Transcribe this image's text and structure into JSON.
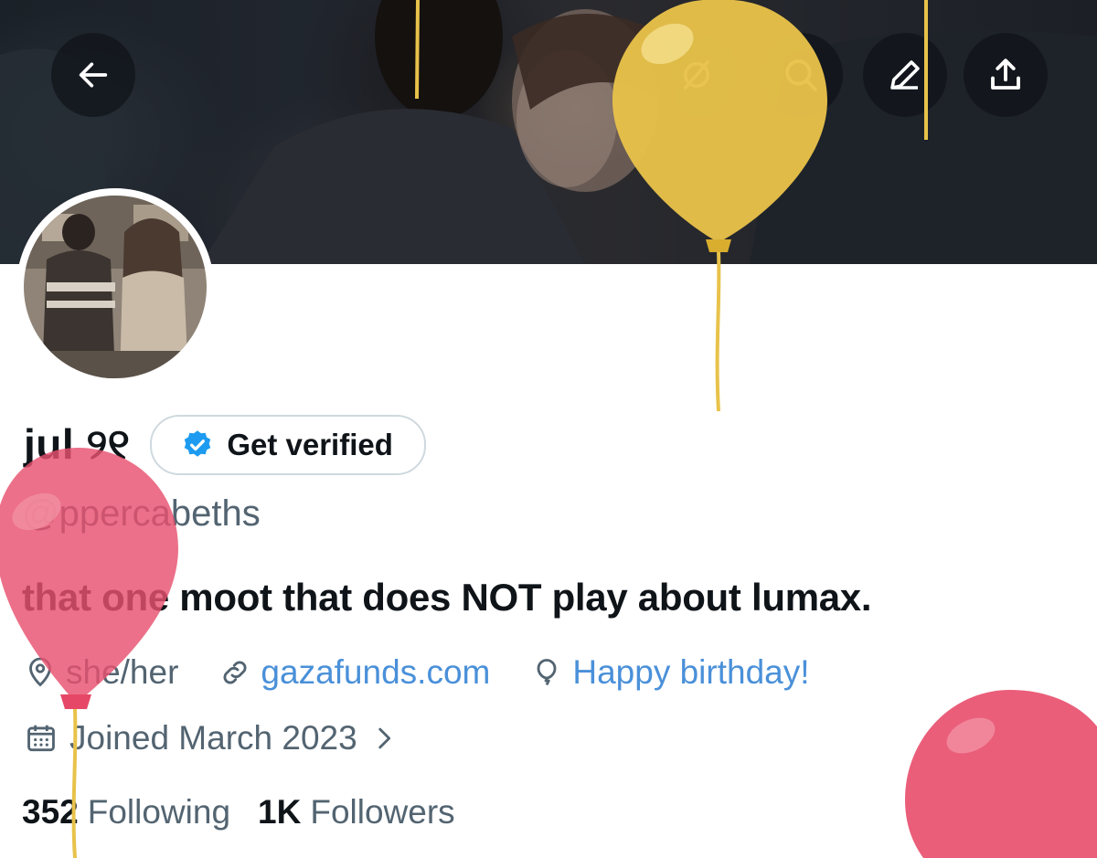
{
  "profile": {
    "display_name": "jul ୨୧",
    "verify_label": "Get verified",
    "handle": "@ppercabeths",
    "bio": "that one moot that does NOT play about lumax.",
    "location": "she/her",
    "website": "gazafunds.com",
    "birthday": "Happy birthday!",
    "joined": "Joined March 2023",
    "following_count": "352",
    "following_label": "Following",
    "followers_count": "1K",
    "followers_label": "Followers"
  },
  "icons": {
    "back": "back-arrow-icon",
    "grok": "grok-icon",
    "search": "search-icon",
    "edit": "edit-pencil-icon",
    "share": "share-icon",
    "verified": "verified-badge-icon",
    "location": "location-pin-icon",
    "link": "link-icon",
    "birthday": "balloon-icon",
    "calendar": "calendar-icon",
    "chevron": "chevron-right-icon"
  },
  "colors": {
    "text": "#0f1419",
    "secondary": "#536471",
    "link": "#4a90d9",
    "verified_blue": "#1d9bf0",
    "balloon_yellow": "#e8c24a",
    "balloon_pink": "#e8506f"
  }
}
